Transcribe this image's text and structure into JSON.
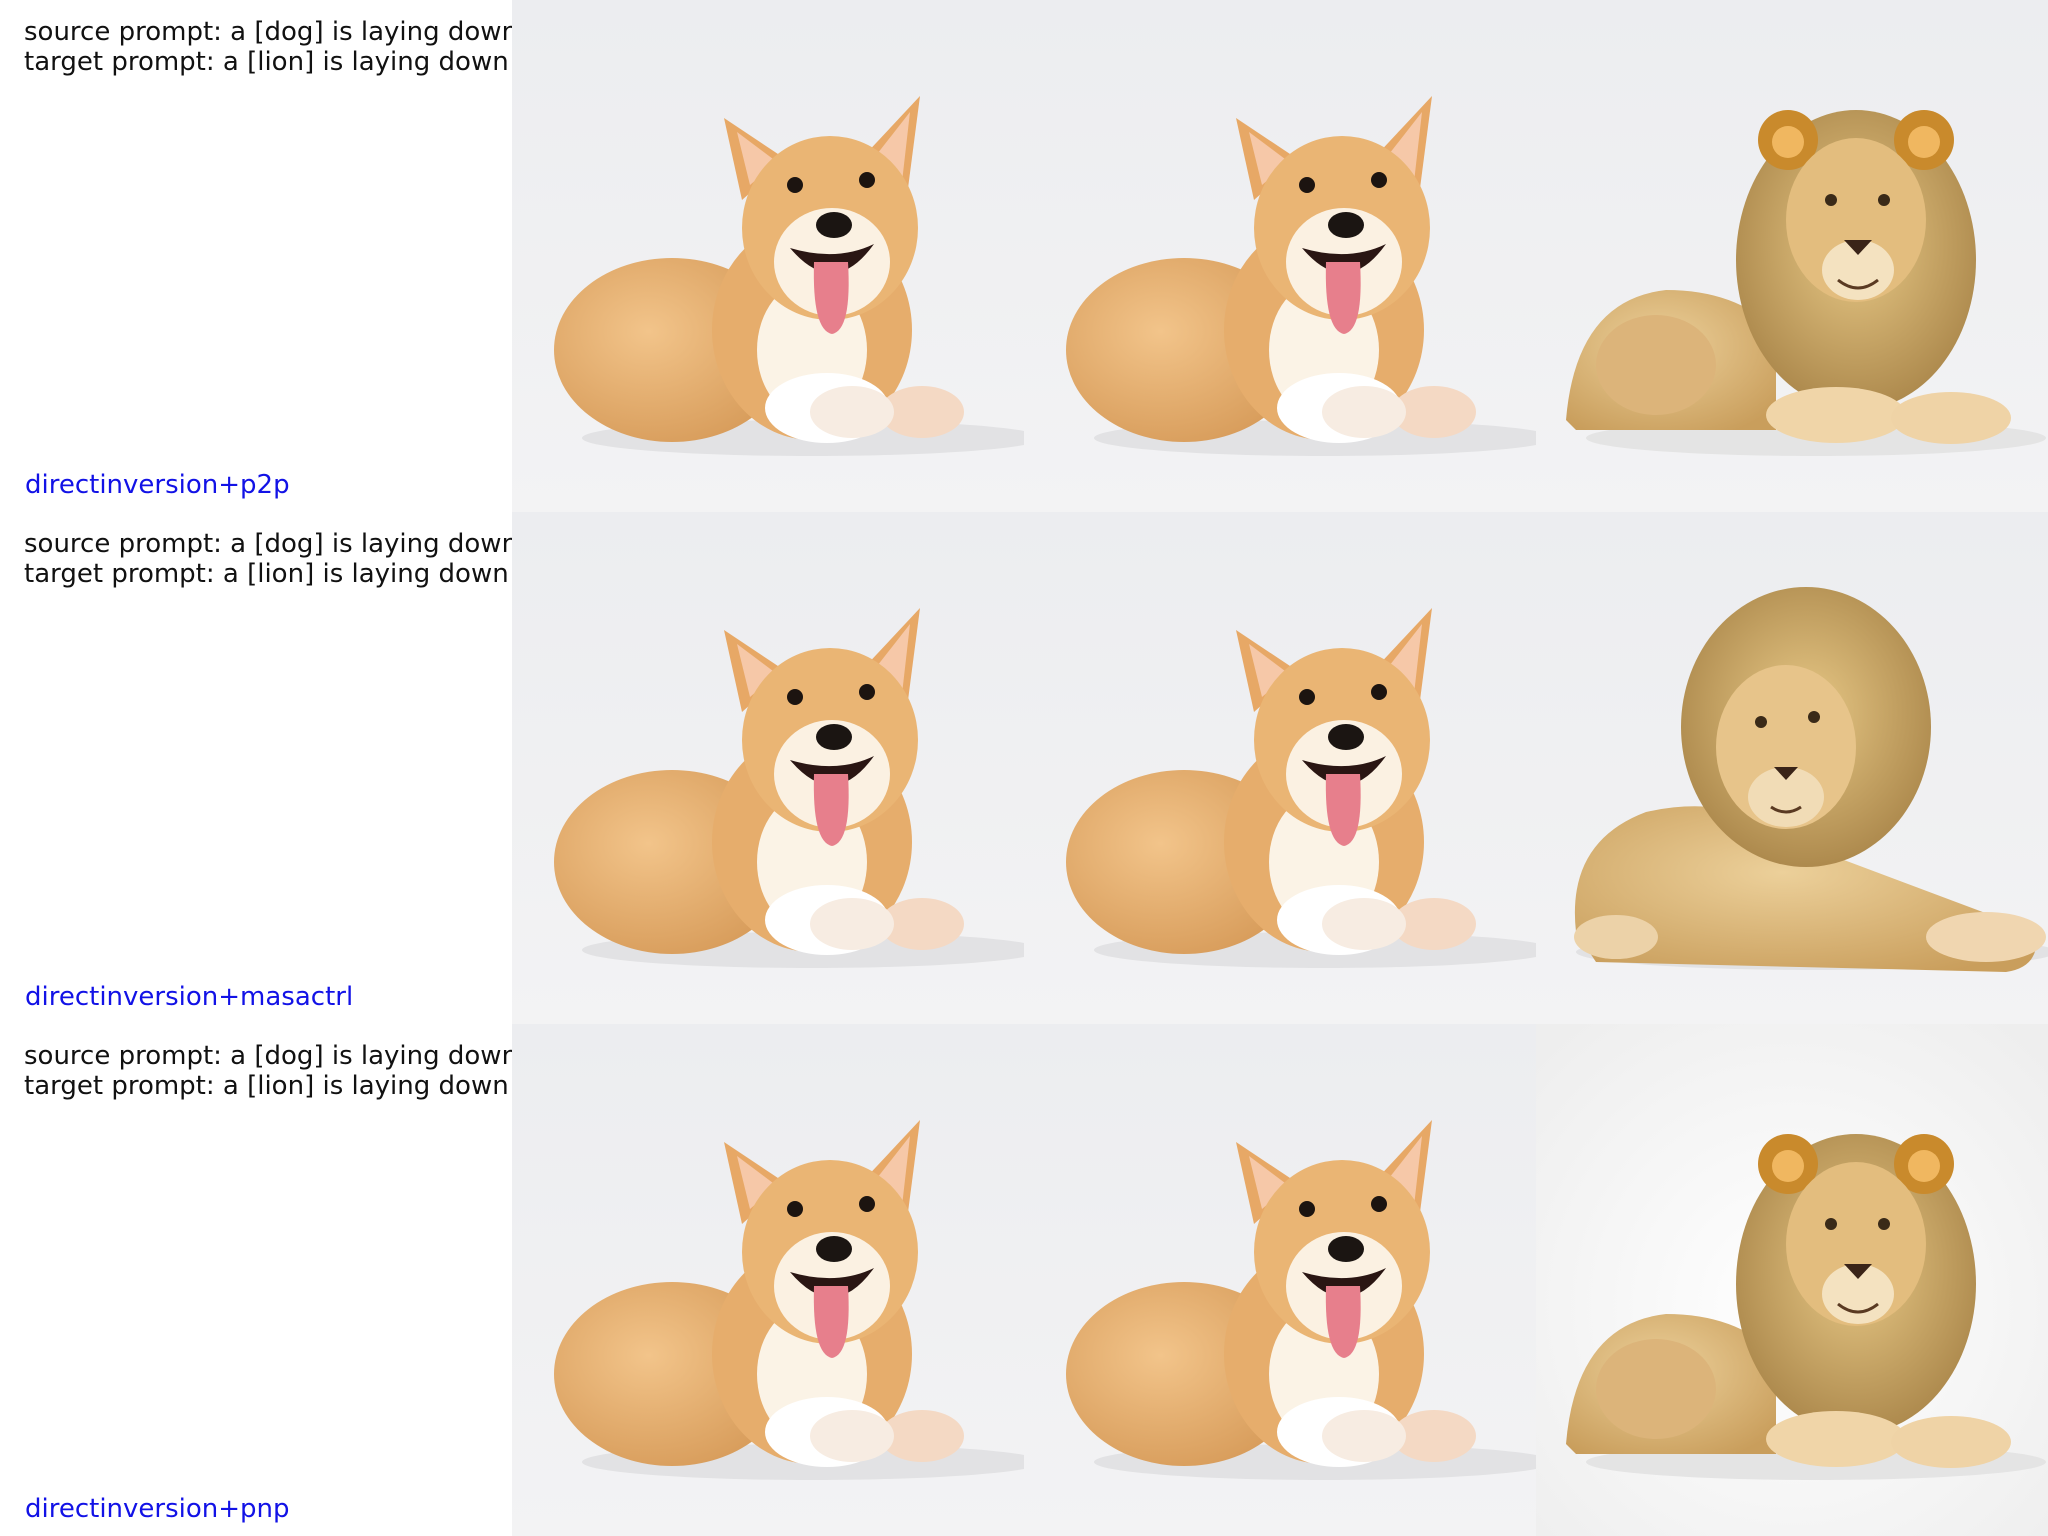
{
  "rows": [
    {
      "source_prompt": "source prompt: a [dog] is laying down on a white background",
      "target_prompt": "target prompt: a [lion] is laying down on a white background",
      "method": "directinversion+p2p",
      "images": [
        "corgi-photo",
        "corgi-photo",
        "lion-photo"
      ]
    },
    {
      "source_prompt": "source prompt: a [dog] is laying down on a white background",
      "target_prompt": "target prompt: a [lion] is laying down on a white background",
      "method": "directinversion+masactrl",
      "images": [
        "corgi-photo",
        "corgi-photo",
        "lion-photo"
      ]
    },
    {
      "source_prompt": "source prompt: a [dog] is laying down on a white background",
      "target_prompt": "target prompt: a [lion] is laying down on a white background",
      "method": "directinversion+pnp",
      "images": [
        "corgi-photo",
        "corgi-photo",
        "lion-photo"
      ]
    }
  ],
  "colors": {
    "method_label": "#1212e6",
    "prompt_text": "#111111",
    "photo_background": "#ececef"
  }
}
